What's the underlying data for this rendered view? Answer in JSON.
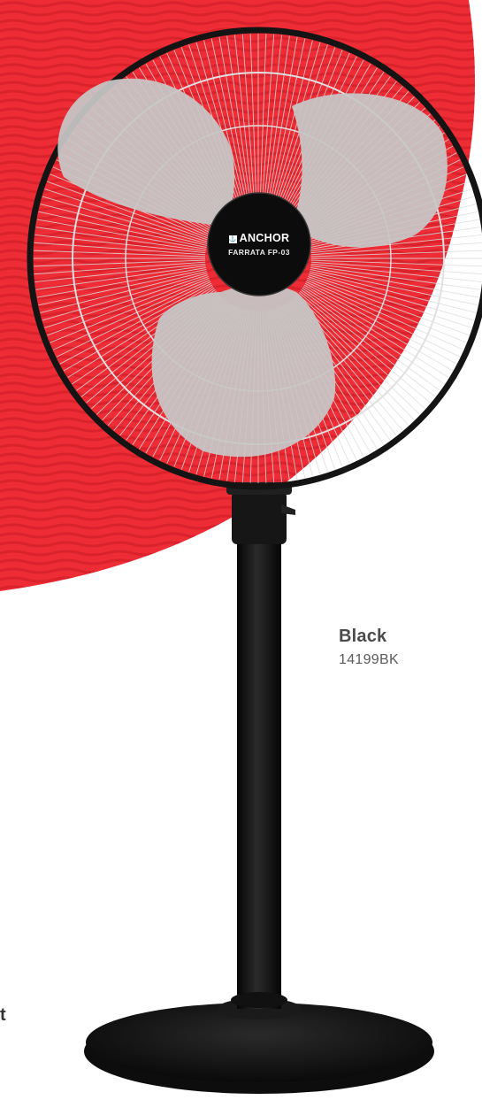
{
  "product": {
    "brand": "ANCHOR",
    "model": "FARRATA FP-03",
    "variant": {
      "color_name": "Black",
      "code": "14199BK"
    },
    "edge_text": "t"
  },
  "colors": {
    "accent_red": "#ee2c35",
    "wave_red": "#d9222b",
    "fan_body": "#121212",
    "blade_grey": "#c4c4c4",
    "guard_grey": "#d8d8d8",
    "page_bg": "#ffffff"
  },
  "icons": {
    "brand_logo": "anchor-logo-icon"
  }
}
